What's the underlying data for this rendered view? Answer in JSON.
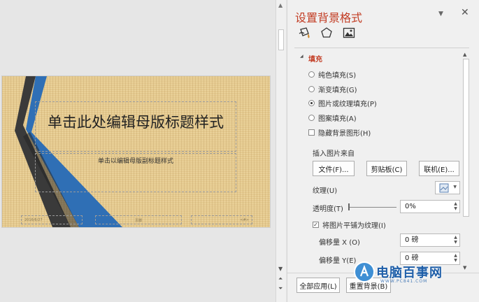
{
  "slide": {
    "title": "单击此处编辑母版标题样式",
    "subtitle": "单击以编辑母版副标题样式",
    "date_placeholder": "2016/6/27",
    "footer_placeholder": "页脚",
    "number_placeholder": "<#>"
  },
  "pane": {
    "title": "设置背景格式",
    "dropdown_icon": "▼",
    "close_icon": "✕",
    "tabs": [
      {
        "name": "fill-tab-icon"
      },
      {
        "name": "effects-tab-icon"
      },
      {
        "name": "picture-tab-icon"
      }
    ],
    "section": {
      "arrow": "◢",
      "label": "填充"
    },
    "fill_options": [
      {
        "label": "纯色填充(S)",
        "selected": false
      },
      {
        "label": "渐变填充(G)",
        "selected": false
      },
      {
        "label": "图片或纹理填充(P)",
        "selected": true
      },
      {
        "label": "图案填充(A)",
        "selected": false
      }
    ],
    "hide_bg_graphics": {
      "label": "隐藏背景图形(H)",
      "checked": false
    },
    "insert_from_label": "插入图片来自",
    "buttons": {
      "file": "文件(F)...",
      "clipboard": "剪贴板(C)",
      "online": "联机(E)..."
    },
    "texture_label": "纹理(U)",
    "transparency_label": "透明度(T)",
    "transparency_value": "0%",
    "tile_checkbox": {
      "label": "将图片平铺为纹理(I)",
      "checked": true
    },
    "offset_x_label": "偏移量 X (O)",
    "offset_x_value": "0 磅",
    "offset_y_label": "偏移量 Y(E)",
    "offset_y_value": "0 磅",
    "apply_all": "全部应用(L)",
    "reset": "重置背景(B)"
  },
  "watermark": {
    "text": "电脑百事网",
    "url": "WWW.PC841.COM"
  },
  "colors": {
    "accent": "#c23b22",
    "ribbon_blue": "#2f6fb5",
    "ribbon_dark": "#3a3a3a",
    "slide_bg": "#e4c98e"
  }
}
